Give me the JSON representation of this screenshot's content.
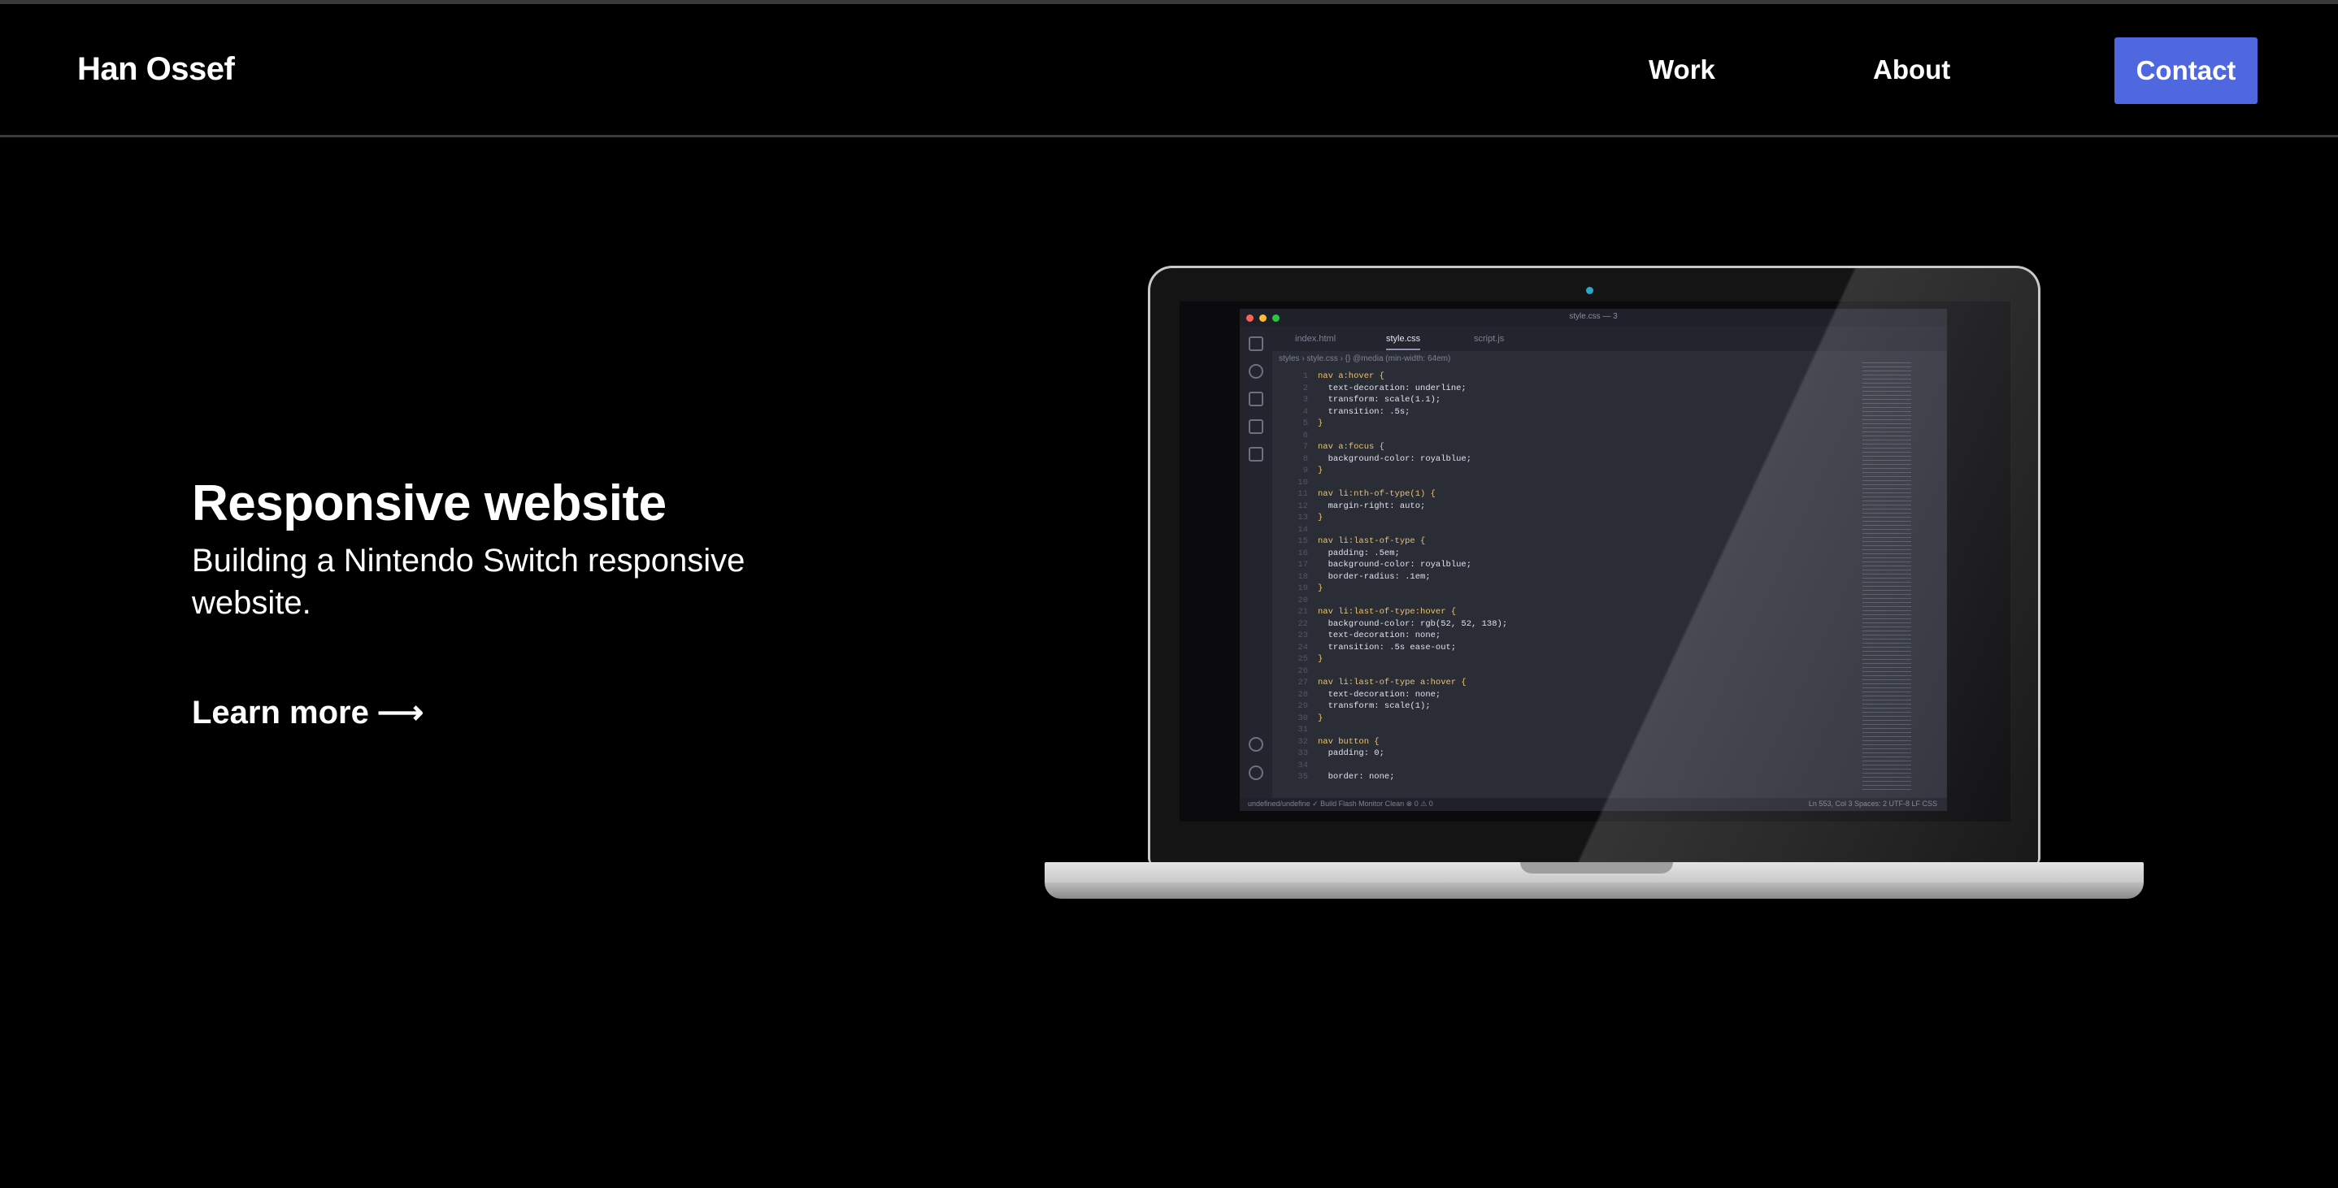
{
  "header": {
    "brand": "Han Ossef",
    "nav": {
      "work": "Work",
      "about": "About"
    },
    "contact": "Contact"
  },
  "hero": {
    "title": "Responsive website",
    "subtitle": "Building a Nintendo Switch responsive website.",
    "cta": "Learn more",
    "cta_arrow": "⟶"
  },
  "editor": {
    "window_title": "style.css — 3",
    "tabs": [
      "index.html",
      "style.css",
      "script.js"
    ],
    "breadcrumbs": "styles › style.css › {} @media (min-width: 64em)",
    "code_lines": [
      "nav a:hover {",
      "  text-decoration: underline;",
      "  transform: scale(1.1);",
      "  transition: .5s;",
      "}",
      "",
      "nav a:focus {",
      "  background-color: royalblue;",
      "}",
      "",
      "nav li:nth-of-type(1) {",
      "  margin-right: auto;",
      "}",
      "",
      "nav li:last-of-type {",
      "  padding: .5em;",
      "  background-color: royalblue;",
      "  border-radius: .1em;",
      "}",
      "",
      "nav li:last-of-type:hover {",
      "  background-color: rgb(52, 52, 138);",
      "  text-decoration: none;",
      "  transition: .5s ease-out;",
      "}",
      "",
      "nav li:last-of-type a:hover {",
      "  text-decoration: none;",
      "  transform: scale(1);",
      "}",
      "",
      "nav button {",
      "  padding: 0;",
      "",
      "  border: none;"
    ],
    "status_left": "undefined/undefine   ✓ Build   Flash   Monitor   Clean   ⊗ 0 ⚠ 0",
    "status_right": "Ln 553, Col 3   Spaces: 2   UTF-8   LF   CSS"
  },
  "icons": [
    "arrow-right-icon",
    "laptop-icon",
    "files-icon",
    "search-icon",
    "source-control-icon",
    "run-icon",
    "extensions-icon",
    "account-icon",
    "settings-icon"
  ],
  "colors": {
    "background": "#000000",
    "contact_button": "#4f68df",
    "nav_text": "#ffffff"
  }
}
